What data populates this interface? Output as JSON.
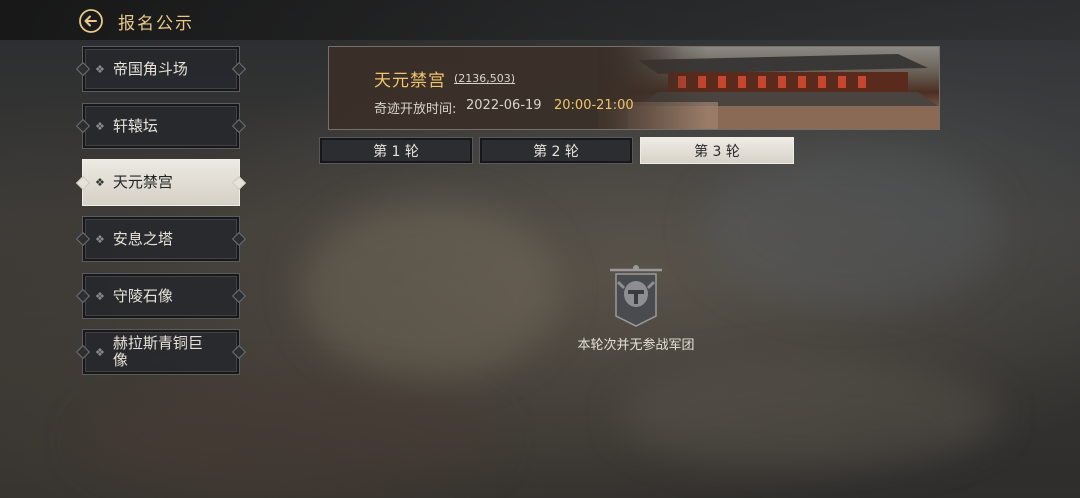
{
  "header": {
    "title": "报名公示",
    "back_icon": "back-arrow-icon"
  },
  "sidebar": {
    "items": [
      {
        "label": "帝国角斗场"
      },
      {
        "label": "轩辕坛"
      },
      {
        "label": "天元禁宫"
      },
      {
        "label": "安息之塔"
      },
      {
        "label": "守陵石像"
      },
      {
        "label": "赫拉斯青铜巨像"
      }
    ],
    "active_index": 2
  },
  "banner": {
    "title": "天元禁宫",
    "coordinates": "(2136,503)",
    "time_label": "奇迹开放时间:",
    "date": "2022-06-19",
    "time_range": "20:00-21:00"
  },
  "rounds": {
    "tabs": [
      {
        "label": "第 1 轮"
      },
      {
        "label": "第 2 轮"
      },
      {
        "label": "第 3 轮"
      }
    ],
    "active_index": 2
  },
  "empty_state": {
    "icon": "war-banner-icon",
    "message": "本轮次并无参战军团"
  },
  "colors": {
    "accent_gold": "#f0c46a",
    "header_gold": "#e8c98a",
    "active_tab_bg": "#e8e4dc"
  }
}
